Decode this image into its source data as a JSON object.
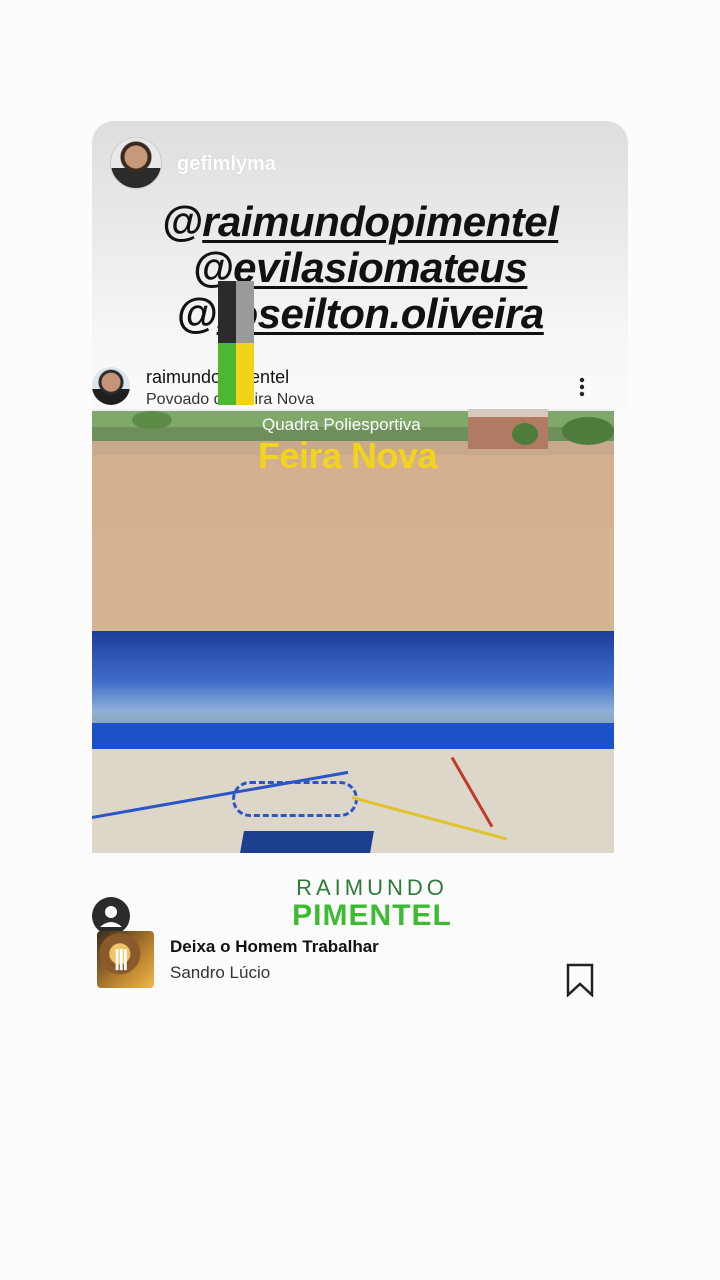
{
  "story": {
    "username": "gefimlyma",
    "mentions": [
      "@raimundopimentel",
      "@evilasiomateus",
      "@roseilton.oliveira"
    ]
  },
  "post": {
    "username": "raimundopimentel",
    "location": "Povoado da Feira Nova",
    "image": {
      "subtitle": "Quadra Poliesportiva",
      "title": "Feira Nova",
      "brand_line1": "RAIMUNDO",
      "brand_line2": "PIMENTEL"
    }
  },
  "music": {
    "title": "Deixa o Homem Trabalhar",
    "artist": "Sandro Lúcio"
  },
  "icons": [
    "more-vertical-icon",
    "profile-icon",
    "bookmark-icon"
  ],
  "colors": {
    "brand_green": "#3dbb32",
    "brand_yellow": "#f2d41c",
    "court_blue": "#1b52c8"
  }
}
